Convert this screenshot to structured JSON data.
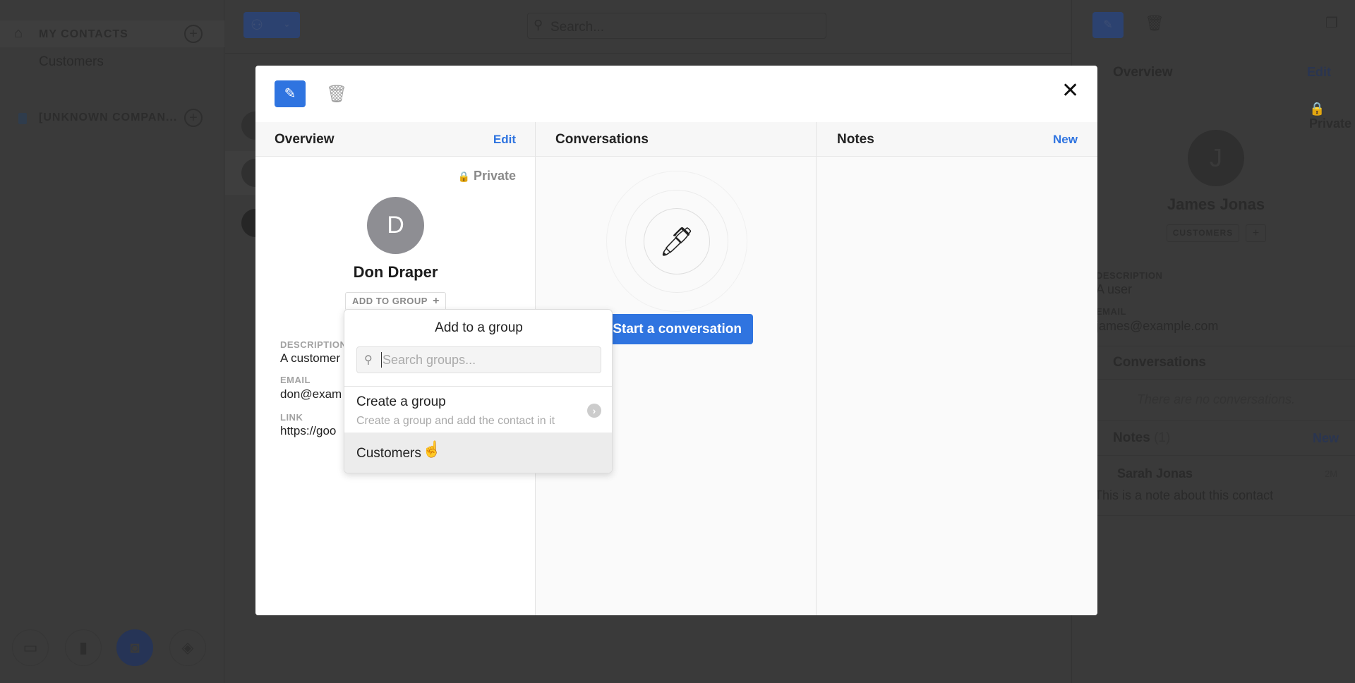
{
  "sidebar": {
    "my_contacts": "MY CONTACTS",
    "groups": [
      "Customers"
    ],
    "company": "[UNKNOWN COMPAN..."
  },
  "topbar": {
    "search_placeholder": "Search..."
  },
  "right_panel": {
    "overview": "Overview",
    "edit": "Edit",
    "private": "Private",
    "avatar_initial": "J",
    "name": "James Jonas",
    "tag": "CUSTOMERS",
    "add_tag": "+",
    "description_label": "DESCRIPTION",
    "description": "A user",
    "email_label": "EMAIL",
    "email": "james@example.com",
    "conversations": "Conversations",
    "no_conversations": "There are no conversations.",
    "notes": "Notes",
    "notes_count": "(1)",
    "new": "New",
    "note_author": "Sarah Jonas",
    "note_time": "2M",
    "note_text": "This is a note about this contact"
  },
  "modal": {
    "overview": {
      "title": "Overview",
      "edit": "Edit",
      "private": "Private",
      "avatar_initial": "D",
      "name": "Don Draper",
      "add_to_group": "ADD TO GROUP",
      "description_label": "DESCRIPTION",
      "description": "A customer",
      "email_label": "EMAIL",
      "email": "don@exam",
      "link_label": "LINK",
      "link": "https://goo"
    },
    "conversations": {
      "title": "Conversations",
      "start": "Start a conversation"
    },
    "notes": {
      "title": "Notes",
      "new": "New"
    }
  },
  "dropdown": {
    "title": "Add to a group",
    "search_placeholder": "Search groups...",
    "create_title": "Create a group",
    "create_subtitle": "Create a group and add the contact in it",
    "groups": [
      "Customers"
    ]
  },
  "colors": {
    "accent": "#2f74e0",
    "avatar": "#8e8e93"
  }
}
